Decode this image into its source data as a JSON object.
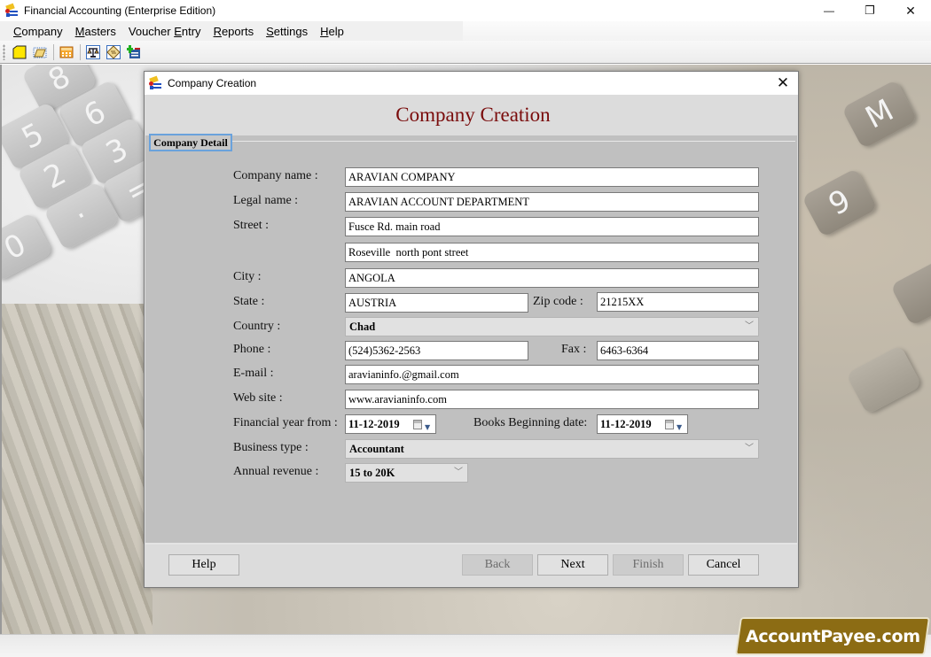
{
  "window": {
    "title": "Financial Accounting (Enterprise Edition)",
    "controls": {
      "minimize": "—",
      "restore": "❐",
      "close": "✕"
    }
  },
  "menu": [
    {
      "label": "Company",
      "accel": "C",
      "rest": "ompany"
    },
    {
      "label": "Masters",
      "accel": "M",
      "rest": "asters"
    },
    {
      "label": "Voucher Entry",
      "pre": "Voucher ",
      "accel": "E",
      "rest": "ntry"
    },
    {
      "label": "Reports",
      "accel": "R",
      "rest": "eports"
    },
    {
      "label": "Settings",
      "accel": "S",
      "rest": "ettings"
    },
    {
      "label": "Help",
      "accel": "H",
      "rest": "elp"
    }
  ],
  "toolbar": {
    "icons": [
      "new-company-icon",
      "open-company-icon",
      "calculator-icon",
      "balance-scale-icon",
      "ledger-icon",
      "add-entry-icon"
    ]
  },
  "dialog": {
    "title": "Company Creation",
    "heading": "Company Creation",
    "group_label": "Company Detail",
    "close": "✕",
    "labels": {
      "company_name": "Company name :",
      "legal_name": "Legal name :",
      "street": "Street :",
      "city": "City :",
      "state": "State :",
      "zip": "Zip code :",
      "country": "Country :",
      "phone": "Phone :",
      "fax": "Fax :",
      "email": "E-mail :",
      "website": "Web site :",
      "fy_from": "Financial year from :",
      "books_beginning": "Books Beginning date:",
      "business_type": "Business type :",
      "annual_revenue": "Annual revenue :"
    },
    "values": {
      "company_name": "ARAVIAN COMPANY",
      "legal_name": "ARAVIAN ACCOUNT DEPARTMENT",
      "street1": "Fusce Rd. main road",
      "street2": "Roseville  north pont street",
      "city": "ANGOLA",
      "state": "AUSTRIA",
      "zip": "21215XX",
      "country": "Chad",
      "phone": "(524)5362-2563",
      "fax": "6463-6364",
      "email": "aravianinfo.@gmail.com",
      "website": "www.aravianinfo.com",
      "fy_from": "11-12-2019",
      "books_beginning": "11-12-2019",
      "business_type": "Accountant",
      "annual_revenue": "15 to 20K"
    },
    "buttons": {
      "help": "Help",
      "back": "Back",
      "next": "Next",
      "finish": "Finish",
      "cancel": "Cancel"
    }
  },
  "brand": {
    "text": "AccountPayee.com",
    "color": "#8c6c14"
  },
  "colors": {
    "heading": "#7a0c0c",
    "group_border": "#6aa2dc",
    "panel": "#c0c0c0"
  }
}
